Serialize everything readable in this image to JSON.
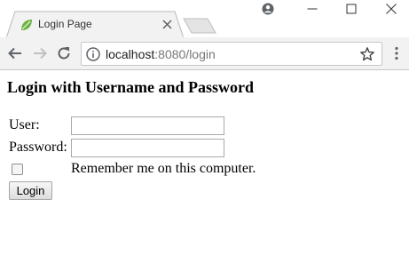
{
  "browser": {
    "tab_title": "Login Page",
    "url_host": "localhost",
    "url_rest": ":8080/login",
    "icons": {
      "favicon": "leaf-icon",
      "tab_close": "close-icon",
      "profile": "person-icon",
      "back": "arrow-left-icon",
      "forward": "arrow-right-icon",
      "reload": "reload-icon",
      "info": "info-icon",
      "bookmark": "star-icon",
      "menu": "kebab-menu-icon"
    },
    "colors": {
      "favicon": "#6db33f",
      "toolbar": "#f2f2f2"
    }
  },
  "page": {
    "heading": "Login with Username and Password",
    "user_label": "User:",
    "password_label": "Password:",
    "username_value": "",
    "password_value": "",
    "remember_label": "Remember me on this computer.",
    "remember_checked": false,
    "login_button": "Login"
  }
}
